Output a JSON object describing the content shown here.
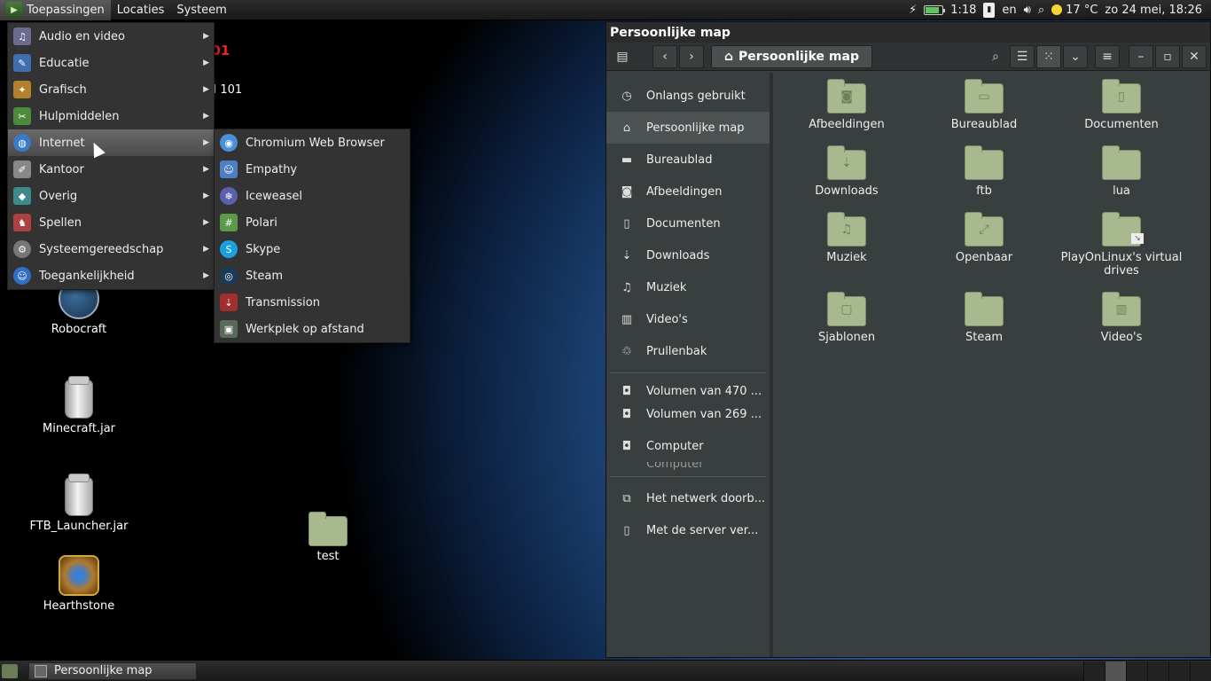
{
  "top_panel": {
    "menus": [
      "Toepassingen",
      "Locaties",
      "Systeem"
    ],
    "battery_time": "1:18",
    "battery_level": 0.75,
    "keyboard_layout": "en",
    "weather": "17 °C",
    "clock": "zo 24 mei, 18:26"
  },
  "desktop": {
    "partial_icon_label": "rd 101",
    "partial_logo_text": "101",
    "icons": [
      {
        "label": "Robocraft"
      },
      {
        "label": "Minecraft.jar"
      },
      {
        "label": "FTB_Launcher.jar"
      },
      {
        "label": "Hearthstone"
      },
      {
        "label": "test"
      }
    ]
  },
  "apps_menu": {
    "items": [
      {
        "label": "Audio en video",
        "icon": "audio-video-icon",
        "color": "#6b6b8f"
      },
      {
        "label": "Educatie",
        "icon": "education-icon",
        "color": "#3f6fb0"
      },
      {
        "label": "Grafisch",
        "icon": "graphics-icon",
        "color": "#b5802c"
      },
      {
        "label": "Hulpmiddelen",
        "icon": "accessories-icon",
        "color": "#4d8a3c"
      },
      {
        "label": "Internet",
        "icon": "internet-icon",
        "color": "#3a7bc8"
      },
      {
        "label": "Kantoor",
        "icon": "office-icon",
        "color": "#888888"
      },
      {
        "label": "Overig",
        "icon": "other-icon",
        "color": "#3c8a8a"
      },
      {
        "label": "Spellen",
        "icon": "games-icon",
        "color": "#b04040"
      },
      {
        "label": "Systeemgereedschap",
        "icon": "system-tools-icon",
        "color": "#777777"
      },
      {
        "label": "Toegankelijkheid",
        "icon": "accessibility-icon",
        "color": "#2f6fc4"
      }
    ],
    "highlighted": "Internet"
  },
  "internet_submenu": {
    "items": [
      {
        "label": "Chromium Web Browser",
        "icon": "chromium-icon",
        "color": "#4a8fd9"
      },
      {
        "label": "Empathy",
        "icon": "empathy-icon",
        "color": "#4c7fc4"
      },
      {
        "label": "Iceweasel",
        "icon": "iceweasel-icon",
        "color": "#5b5fb0"
      },
      {
        "label": "Polari",
        "icon": "polari-icon",
        "color": "#5a9a4a"
      },
      {
        "label": "Skype",
        "icon": "skype-icon",
        "color": "#1aa0e0"
      },
      {
        "label": "Steam",
        "icon": "steam-icon",
        "color": "#1b3b5a"
      },
      {
        "label": "Transmission",
        "icon": "transmission-icon",
        "color": "#a03030"
      },
      {
        "label": "Werkplek op afstand",
        "icon": "remote-desktop-icon",
        "color": "#5a6a5a"
      }
    ]
  },
  "file_manager": {
    "window_title": "Persoonlijke map",
    "path_label": "Persoonlijke map",
    "sidebar": {
      "places": [
        {
          "label": "Onlangs gebruikt",
          "icon": "clock-icon"
        },
        {
          "label": "Persoonlijke map",
          "icon": "home-icon",
          "selected": true
        },
        {
          "label": "Bureaublad",
          "icon": "desktop-folder-icon"
        },
        {
          "label": "Afbeeldingen",
          "icon": "camera-icon"
        },
        {
          "label": "Documenten",
          "icon": "document-icon"
        },
        {
          "label": "Downloads",
          "icon": "download-icon"
        },
        {
          "label": "Muziek",
          "icon": "music-icon"
        },
        {
          "label": "Video's",
          "icon": "film-icon"
        },
        {
          "label": "Prullenbak",
          "icon": "trash-icon"
        }
      ],
      "devices": [
        {
          "label": "Volumen van 470 ...",
          "icon": "drive-icon"
        },
        {
          "label": "Volumen van 269 ...",
          "icon": "drive-icon"
        },
        {
          "label": "Computer",
          "icon": "drive-icon"
        }
      ],
      "device_overlap_text": "Computer",
      "network": [
        {
          "label": "Het netwerk doorb...",
          "icon": "network-icon"
        },
        {
          "label": "Met de server ver...",
          "icon": "server-icon"
        }
      ]
    },
    "files": [
      {
        "label": "Afbeeldingen",
        "emblem": "camera-icon"
      },
      {
        "label": "Bureaublad",
        "emblem": "desktop-icon"
      },
      {
        "label": "Documenten",
        "emblem": "document-icon"
      },
      {
        "label": "Downloads",
        "emblem": "download-icon"
      },
      {
        "label": "ftb",
        "emblem": ""
      },
      {
        "label": "lua",
        "emblem": ""
      },
      {
        "label": "Muziek",
        "emblem": "music-icon"
      },
      {
        "label": "Openbaar",
        "emblem": "share-icon"
      },
      {
        "label": "PlayOnLinux's virtual drives",
        "emblem": "link-icon"
      },
      {
        "label": "Sjablonen",
        "emblem": "template-icon"
      },
      {
        "label": "Steam",
        "emblem": ""
      },
      {
        "label": "Video's",
        "emblem": "film-icon"
      }
    ]
  },
  "bottom_panel": {
    "task_label": "Persoonlijke map"
  }
}
